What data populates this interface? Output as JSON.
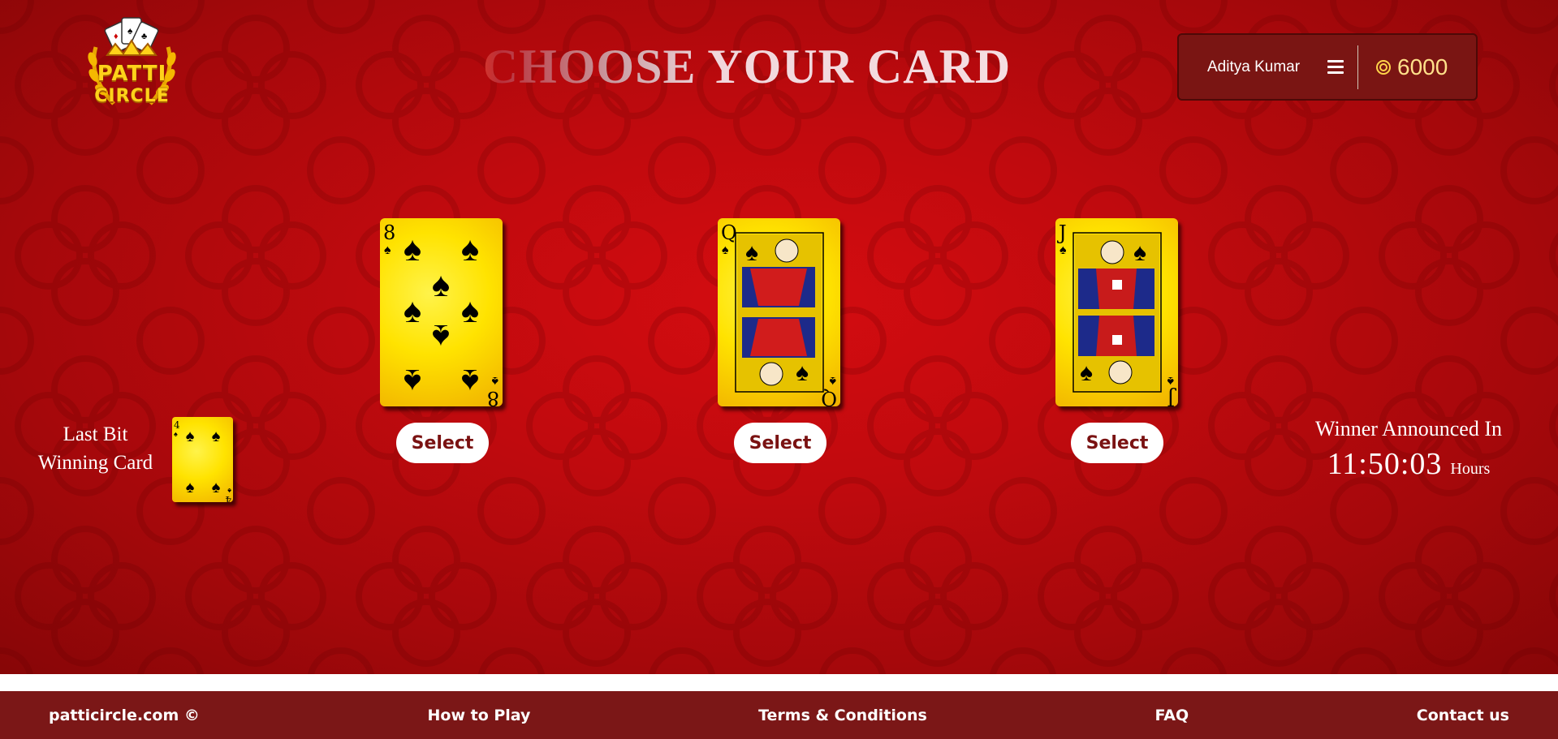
{
  "header": {
    "logo_line1": "PATTI",
    "logo_line2": "CIRCLE",
    "title": "CHOOSE YOUR CARD"
  },
  "user": {
    "name": "Aditya Kumar",
    "coins": "6000",
    "menu_icon": "hamburger-menu-icon",
    "coin_icon": "coin-icon"
  },
  "cards": [
    {
      "rank": "8",
      "suit": "spades",
      "select_label": "Select"
    },
    {
      "rank": "Q",
      "suit": "spades",
      "select_label": "Select"
    },
    {
      "rank": "J",
      "suit": "spades",
      "select_label": "Select"
    }
  ],
  "last_bit": {
    "label_line1": "Last Bit",
    "label_line2": "Winning Card",
    "card_rank": "4",
    "card_suit": "spades"
  },
  "winner": {
    "label": "Winner Announced In",
    "time": "11:50:03",
    "unit": "Hours"
  },
  "footer": {
    "copyright": "patticircle.com ©",
    "how_to_play": "How to Play",
    "terms": "Terms & Conditions",
    "faq": "FAQ",
    "contact": "Contact us"
  },
  "colors": {
    "background": "#c00a0e",
    "card_face": "#ffe300",
    "footer": "#7b1717",
    "user_box": "#7a1513",
    "coin_text": "#ffe08a"
  }
}
